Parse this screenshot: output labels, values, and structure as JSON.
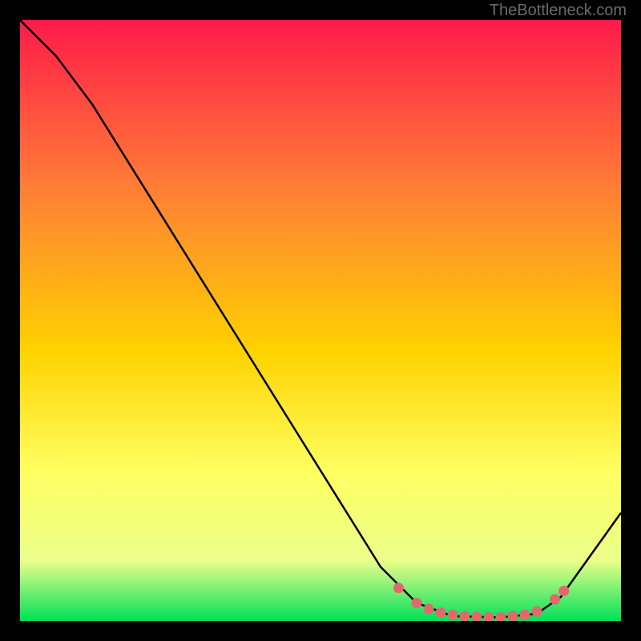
{
  "attribution": "TheBottleneck.com",
  "colors": {
    "background": "#000000",
    "gradient_top": "#ff1a4a",
    "gradient_mid1": "#ff7e36",
    "gradient_mid2": "#ffd200",
    "gradient_mid3": "#ffff60",
    "gradient_low": "#eaff8a",
    "gradient_bottom": "#00e05a",
    "curve": "#000000",
    "marker_fill": "#e2686e",
    "marker_stroke": "#e2686e"
  },
  "chart_data": {
    "type": "line",
    "title": "",
    "xlabel": "",
    "ylabel": "",
    "xlim": [
      0,
      100
    ],
    "ylim": [
      0,
      100
    ],
    "curve": [
      {
        "x": 0,
        "y": 100
      },
      {
        "x": 6,
        "y": 94
      },
      {
        "x": 12,
        "y": 86
      },
      {
        "x": 60,
        "y": 9
      },
      {
        "x": 66,
        "y": 3
      },
      {
        "x": 72,
        "y": 0.8
      },
      {
        "x": 80,
        "y": 0.6
      },
      {
        "x": 86,
        "y": 1.2
      },
      {
        "x": 90,
        "y": 4
      },
      {
        "x": 100,
        "y": 18
      }
    ],
    "markers": [
      {
        "x": 63,
        "y": 5.5
      },
      {
        "x": 66,
        "y": 3.0
      },
      {
        "x": 68,
        "y": 2.0
      },
      {
        "x": 70,
        "y": 1.4
      },
      {
        "x": 72,
        "y": 1.0
      },
      {
        "x": 74,
        "y": 0.8
      },
      {
        "x": 76,
        "y": 0.7
      },
      {
        "x": 78,
        "y": 0.6
      },
      {
        "x": 80,
        "y": 0.6
      },
      {
        "x": 82,
        "y": 0.8
      },
      {
        "x": 84,
        "y": 1.0
      },
      {
        "x": 86,
        "y": 1.6
      },
      {
        "x": 89,
        "y": 3.6
      },
      {
        "x": 90.5,
        "y": 5.0
      }
    ]
  }
}
